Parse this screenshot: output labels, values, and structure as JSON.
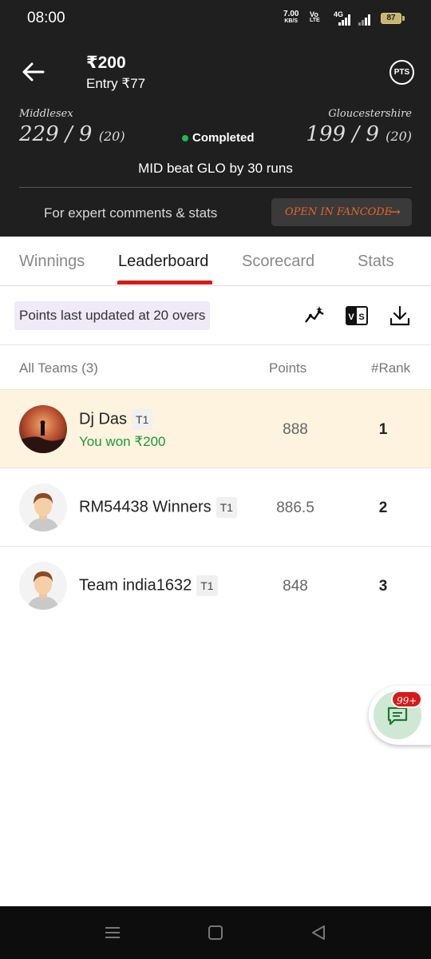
{
  "status_bar": {
    "time": "08:00",
    "speed_value": "7.00",
    "speed_unit": "KB/S",
    "volte_top": "Vo",
    "volte_bottom": "LTE",
    "network": "4G",
    "battery": "87"
  },
  "header": {
    "prize": "₹200",
    "entry": "Entry ₹77",
    "pts_label": "PTS",
    "team_left": {
      "name": "Middlesex",
      "score": "229 / 9",
      "overs": "(20)"
    },
    "team_right": {
      "name": "Gloucestershire",
      "score": "199 / 9",
      "overs": "(20)"
    },
    "match_status": "Completed",
    "result": "MID beat GLO by 30 runs",
    "expert_text": "For expert comments & stats",
    "fancode_label": "OPEN IN FANCODE",
    "colors": {
      "accent": "#d61a1a",
      "status_green": "#1db954",
      "fancode": "#e8632a"
    }
  },
  "tabs": [
    {
      "label": "Winnings"
    },
    {
      "label": "Leaderboard",
      "active": true
    },
    {
      "label": "Scorecard"
    },
    {
      "label": "Stats"
    }
  ],
  "toolbar": {
    "update_text": "Points last updated at 20 overs",
    "icons": [
      "trend-icon",
      "versus-icon",
      "download-icon"
    ]
  },
  "list": {
    "header_teams": "All Teams (3)",
    "header_points": "Points",
    "header_rank": "#Rank",
    "rows": [
      {
        "name": "Dj Das",
        "tag": "T1",
        "subtitle": "You won ₹200",
        "points": "888",
        "rank": "1"
      },
      {
        "name": "RM54438 Winners",
        "tag": "T1",
        "points": "886.5",
        "rank": "2"
      },
      {
        "name": "Team india1632",
        "tag": "T1",
        "points": "848",
        "rank": "3"
      }
    ]
  },
  "chat": {
    "badge": "99+"
  }
}
